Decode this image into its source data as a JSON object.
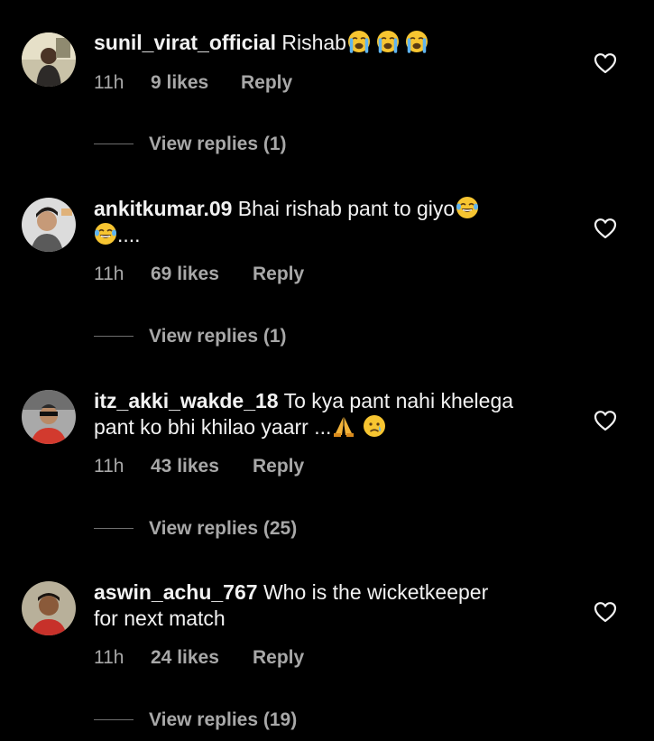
{
  "comments": [
    {
      "username": "sunil_virat_official",
      "text": " Rishab",
      "line2": "",
      "time": "11h",
      "likes": "9 likes",
      "reply": "Reply",
      "view_replies": "View replies (1)"
    },
    {
      "username": "ankitkumar.09",
      "text": " Bhai rishab pant to giyo",
      "line2": "....",
      "time": "11h",
      "likes": "69 likes",
      "reply": "Reply",
      "view_replies": "View replies (1)"
    },
    {
      "username": "itz_akki_wakde_18",
      "text": " To kya pant nahi khelega",
      "line2": "pant ko bhi khilao yaarr ...",
      "time": "11h",
      "likes": "43 likes",
      "reply": "Reply",
      "view_replies": "View replies (25)"
    },
    {
      "username": "aswin_achu_767",
      "text": " Who is the wicketkeeper",
      "line2": "for next match",
      "time": "11h",
      "likes": "24 likes",
      "reply": "Reply",
      "view_replies": "View replies (19)"
    }
  ],
  "icons": {
    "heart": "heart-outline-icon",
    "crying": "loudly-crying-face-emoji",
    "joy": "face-with-tears-of-joy-emoji",
    "pray": "folded-hands-emoji",
    "cry": "crying-face-emoji"
  },
  "colors": {
    "background": "#000000",
    "text": "#f2f2f2",
    "secondary": "#a8a8a8"
  }
}
